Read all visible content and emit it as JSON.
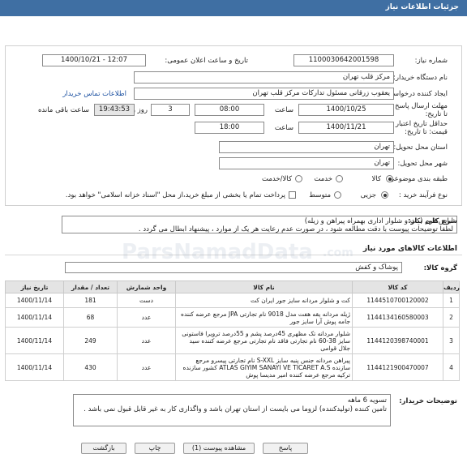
{
  "header": {
    "title": "جزئیات اطلاعات نیاز"
  },
  "form": {
    "need_number": {
      "label": "شماره نیاز:",
      "value": "1100030642001598"
    },
    "announce": {
      "label": "تاریخ و ساعت اعلان عمومی:",
      "value": "1400/10/21 - 12:07"
    },
    "buyer_org": {
      "label": "نام دستگاه خریدار:",
      "value": "مرکز قلب تهران"
    },
    "creator": {
      "label": "ایجاد کننده درخواست:",
      "value": "یعقوب زرقانی مسئول تدارکات مرکز قلب تهران",
      "contact_link": "اطلاعات تماس خریدار"
    },
    "deadline": {
      "label": "مهلت ارسال پاسخ: تا تاریخ:",
      "date": "1400/10/25",
      "time_label": "ساعت",
      "time": "08:00",
      "days": "3",
      "days_label": "روز و",
      "remaining": "19:43:53",
      "remaining_label": "ساعت باقی مانده"
    },
    "validity": {
      "label": "حداقل تاریخ اعتبار قیمت: تا تاریخ:",
      "date": "1400/11/21",
      "time_label": "ساعت",
      "time": "18:00"
    },
    "province": {
      "label": "استان محل تحویل:",
      "value": "تهران"
    },
    "city": {
      "label": "شهر محل تحویل:",
      "value": "تهران"
    },
    "category": {
      "label": "طبقه بندی موضوعی:",
      "options": [
        "کالا",
        "خدمت",
        "کالا/خدمت"
      ],
      "selected": "کالا"
    },
    "process": {
      "label": "نوع فرآیند خرید :",
      "options": [
        "جزیی",
        "متوسط"
      ],
      "selected": "جزیی",
      "checkbox_text": "پرداخت تمام یا بخشی از مبلغ خرید،از محل \"اسناد خزانه اسلامی\" خواهد بود."
    }
  },
  "description": {
    "label": "شرح کلی نیاز:",
    "line1": "لباس فرم (کت و شلوار اداری بهمراه پیراهن و زیله)",
    "line2": "لطفا توضیحات پیوست با دقت مطالعه شود ، در صورت عدم رعایت هر یک از موارد ، پیشنهاد ابطال می گردد ."
  },
  "goods": {
    "section_title": "اطلاعات کالاهای مورد نیاز",
    "group_label": "گروه کالا:",
    "group_value": "پوشاک و کفش",
    "columns": {
      "row": "ردیف",
      "code": "کد کالا",
      "name": "نام کالا",
      "unit": "واحد شمارش",
      "qty": "تعداد / مقدار",
      "date": "تاریخ نیاز"
    },
    "rows": [
      {
        "row": "1",
        "code": "1144510700120002",
        "name": "کت و شلوار مردانه سایز جور ایران کت",
        "unit": "دست",
        "qty": "181",
        "date": "1400/11/14"
      },
      {
        "row": "2",
        "code": "1144134160580003",
        "name": "ژیله مردانه یقه هفت مدل 9018 نام تجارتی JPA مرجع عرضه کننده جامه پوش آرا سایز جور",
        "unit": "عدد",
        "qty": "68",
        "date": "1400/11/14"
      },
      {
        "row": "3",
        "code": "1144120398740001",
        "name": "شلوار مردانه تک مظهری 45درصد پشم و 55درصد ترویرا فاستونی سایز 38-60 نام تجارتی فاقد نام تجارتی مرجع عرضه کننده سید جلال قوامی",
        "unit": "عدد",
        "qty": "249",
        "date": "1400/11/14"
      },
      {
        "row": "4",
        "code": "1144121900470007",
        "name": "پیراهن مردانه جنس پنبه سایز S-XXL نام تجارتی پیسرو مرجع سازنده ATLAS GIYIM SANAYI VE TICARET A.S کشور سازنده ترکیه مرجع عرضه کننده امیر مدیسا پوش",
        "unit": "عدد",
        "qty": "430",
        "date": "1400/11/14"
      }
    ]
  },
  "notes": {
    "label": "توضیحات خریدار:",
    "line1": "تسویه 6 ماهه",
    "line2": "تامین کننده (تولیدکننده) لزوما می بایست از استان تهران باشد و واگذاری کار به غیر قابل قبول نمی باشد ."
  },
  "footer": {
    "buttons": [
      "بازگشت",
      "چاپ",
      "مشاهده پیوست (1)",
      "پاسخ"
    ]
  },
  "watermark": {
    "site": "ParsNamadData",
    "domain": ".com"
  },
  "colors": {
    "header": "#3f6fa3",
    "link": "#1a4fa0",
    "table_header": "#e4e4e4"
  }
}
